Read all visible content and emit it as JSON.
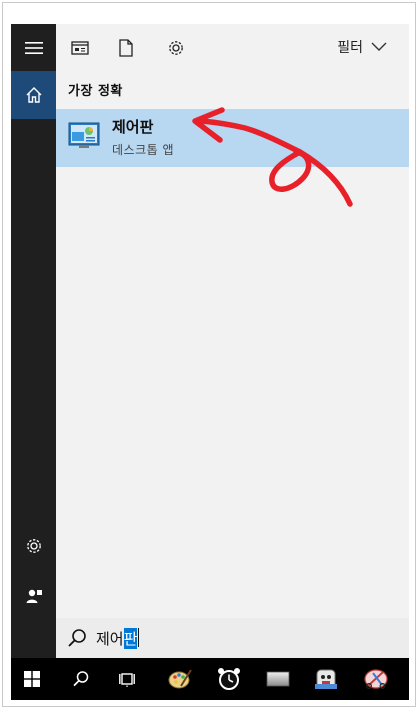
{
  "toolbar": {
    "filter_label": "필터"
  },
  "section": {
    "title": "가장 정확"
  },
  "result": {
    "title": "제어판",
    "subtitle": "데스크톱 앱"
  },
  "search": {
    "typed_text": "제어",
    "selected_text": "판"
  },
  "colors": {
    "sidebar": "#1f1f1f",
    "active": "#1e4a7a",
    "result_highlight": "#b8d7f1",
    "selection": "#0078d7",
    "annotation": "#e8202a"
  },
  "icons": {
    "sidebar": [
      "hamburger-icon",
      "home-icon",
      "settings-icon",
      "user-icon"
    ],
    "toolbar": [
      "apps-icon",
      "documents-icon",
      "settings-icon",
      "chevron-down-icon"
    ],
    "taskbar": [
      "windows-start-icon",
      "search-icon",
      "task-view-icon",
      "paint-app-icon",
      "alarms-app-icon",
      "generic-window-icon",
      "character-app-icon",
      "snipping-app-icon"
    ]
  }
}
